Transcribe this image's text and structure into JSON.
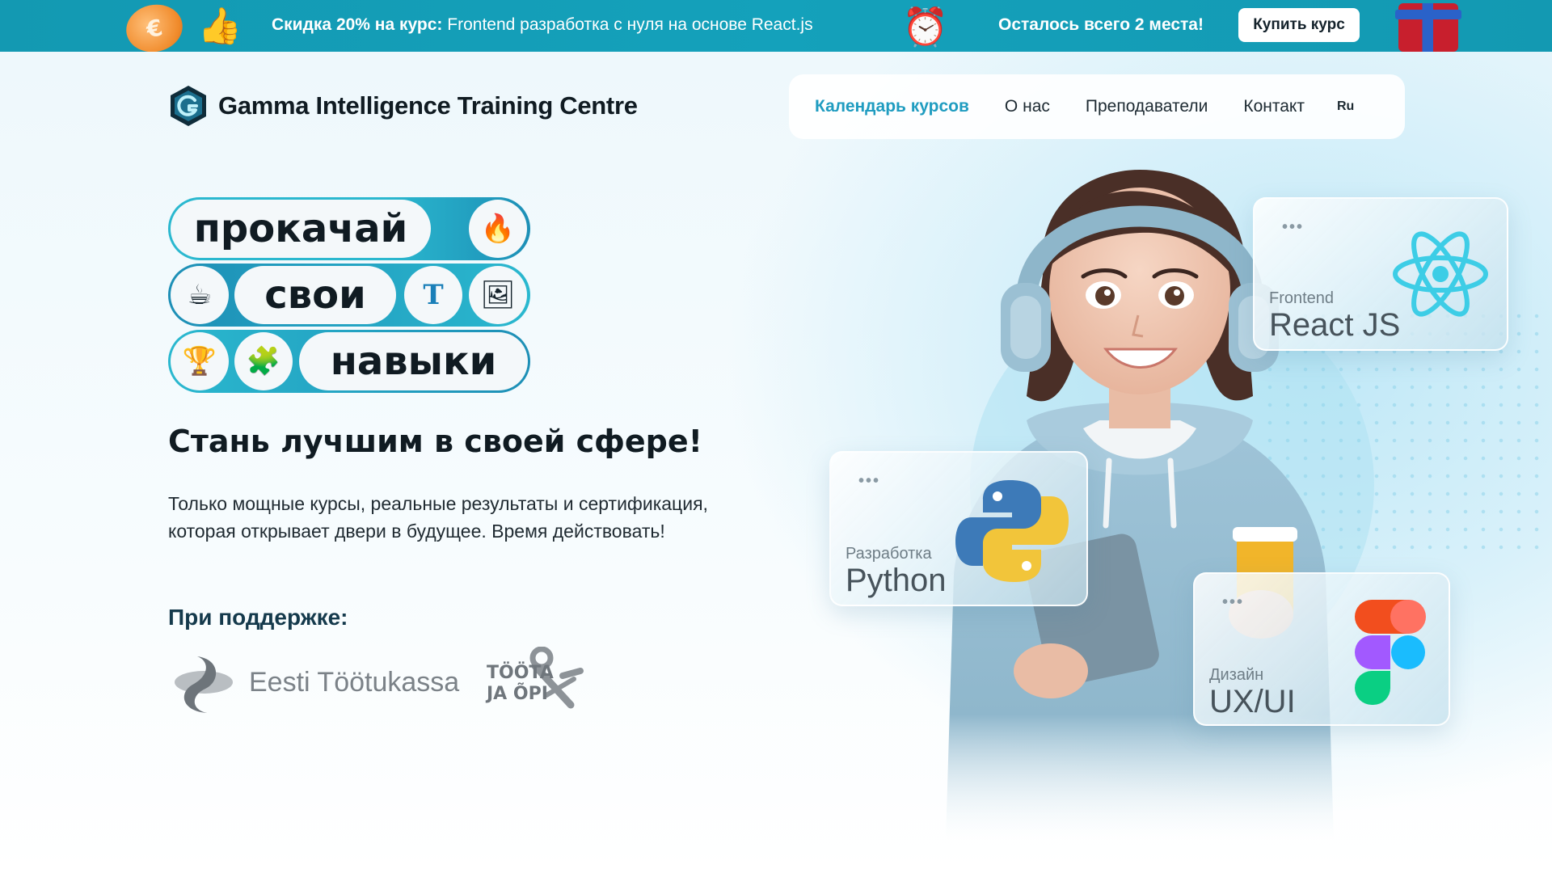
{
  "promo": {
    "discount_bold": "Скидка 20% на курс:",
    "course_text": "Frontend разработка с нуля на основе React.js",
    "seats_text": "Осталось всего 2 места!",
    "buy_button": "Купить курс",
    "coin_symbol": "€"
  },
  "header": {
    "logo_name": "Gamma Intelligence Training Centre",
    "nav": {
      "calendar": "Календарь курсов",
      "about": "О нас",
      "teachers": "Преподаватели",
      "contact": "Контакт",
      "language": "Ru"
    }
  },
  "hero": {
    "pill_words": [
      "прокачай",
      "свои",
      "навыки"
    ],
    "pill_icons": [
      "fire-icon",
      "cup-icon",
      "text-tool-icon",
      "image-icon",
      "trophy-icon",
      "puzzle-icon"
    ],
    "headline": "Стань лучшим в своей сфере!",
    "lead": "Только мощные курсы, реальные результаты и сертификация, которая открывает двери в будущее. Время действовать!",
    "support_title": "При поддержке:",
    "partners": {
      "p1_name": "Eesti Töötukassa",
      "p2_line1": "TÖÖTA",
      "p2_line2": "JA ÕPI"
    }
  },
  "cards": [
    {
      "dots": "•••",
      "small": "Frontend",
      "big": "React JS",
      "icon": "react-logo-icon"
    },
    {
      "dots": "•••",
      "small": "Разработка",
      "big": "Python",
      "icon": "python-logo-icon"
    },
    {
      "dots": "•••",
      "small": "Дизайн",
      "big": "UX/UI",
      "icon": "figma-logo-icon"
    }
  ],
  "colors": {
    "promo_bg": "#14a1bb",
    "accent": "#1f9cc0",
    "pill_band": "#2ab8cf",
    "text_dark": "#101b22"
  }
}
